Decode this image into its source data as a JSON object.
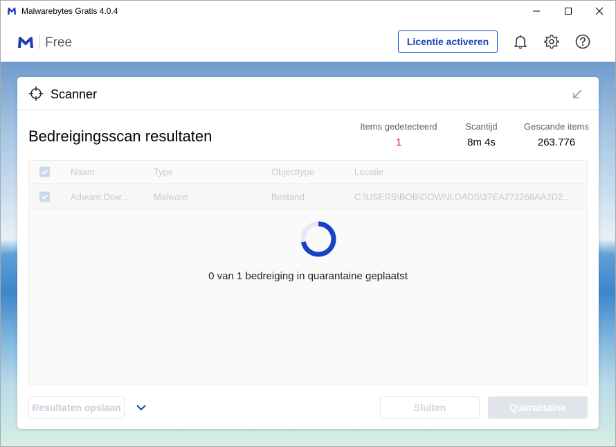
{
  "window": {
    "title": "Malwarebytes Gratis  4.0.4",
    "icons": {
      "app": "malwarebytes-logo-icon",
      "minimize": "minimize-icon",
      "maximize": "maximize-icon",
      "close": "close-icon"
    }
  },
  "header": {
    "edition": "Free",
    "license_button": "Licentie activeren",
    "icons": [
      "bell-icon",
      "gear-icon",
      "help-icon"
    ]
  },
  "scanner": {
    "title": "Scanner",
    "results_title": "Bedreigingsscan resultaten",
    "stats": [
      {
        "label": "Items gedetecteerd",
        "value": "1"
      },
      {
        "label": "Scantijd",
        "value": "8m 4s"
      },
      {
        "label": "Gescande items",
        "value": "263.776"
      }
    ],
    "table": {
      "columns": [
        "Naam",
        "Type",
        "Objecttype",
        "Locatie"
      ],
      "rows": [
        {
          "name": "Adware.Dow...",
          "type": "Malware",
          "object_type": "Bestand",
          "location": "C:\\USERS\\BOB\\DOWNLOADS\\37EA273266AA2D2..."
        }
      ]
    },
    "status": "0 van 1 bedreiging in quarantaine geplaatst",
    "progress_fraction": 0.72,
    "buttons": {
      "save": "Resultaten opslaan",
      "close": "Sluiten",
      "quarantine": "Quarantaine"
    }
  },
  "colors": {
    "accent": "#1a4ad4",
    "detected": "#d21f1f",
    "spinner_track": "#e6e9f2",
    "spinner_fill": "#1940c9"
  }
}
